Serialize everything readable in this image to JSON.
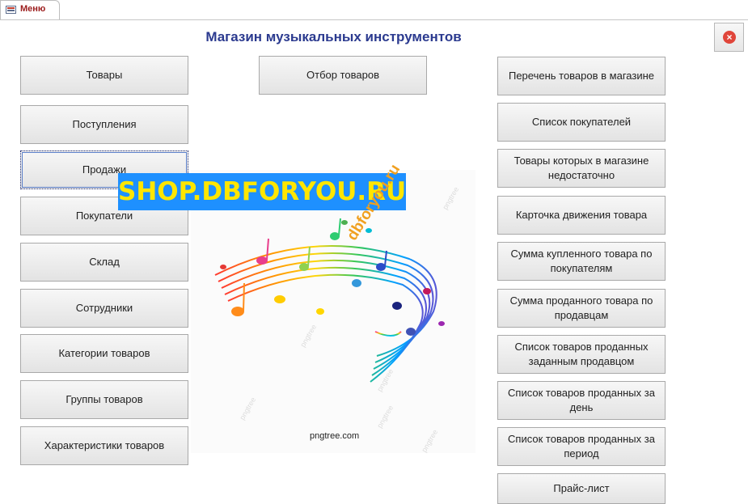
{
  "tab": {
    "label": "Меню"
  },
  "title": "Магазин музыкальных инструментов",
  "close_symbol": "×",
  "left_buttons": [
    "Товары",
    "Поступления",
    "Продажи",
    "Покупатели",
    "Склад",
    "Сотрудники",
    "Категории товаров",
    "Группы товаров",
    "Характеристики товаров"
  ],
  "middle_buttons": [
    "Отбор товаров"
  ],
  "right_buttons": [
    "Перечень товаров в магазине",
    "Список покупателей",
    "Товары которых в магазине недостаточно",
    "Карточка движения товара",
    "Сумма купленного товара по покупателям",
    "Сумма проданного товара по продавцам",
    "Список товаров проданных заданным продавцом",
    "Список товаров проданных за день",
    "Список товаров проданных за период",
    "Прайс-лист"
  ],
  "picture": {
    "banner": "SHOP.DBFORYOU.RU",
    "diagonal_watermark": "dbforyou.ru",
    "credit": "pngtree.com",
    "tile_watermark": "pngtree"
  },
  "colors": {
    "title": "#2b3a8f",
    "banner_bg": "#1e90ff",
    "banner_text": "#ffe600",
    "tab_label": "#9b1b1b",
    "close": "#e0453a"
  }
}
